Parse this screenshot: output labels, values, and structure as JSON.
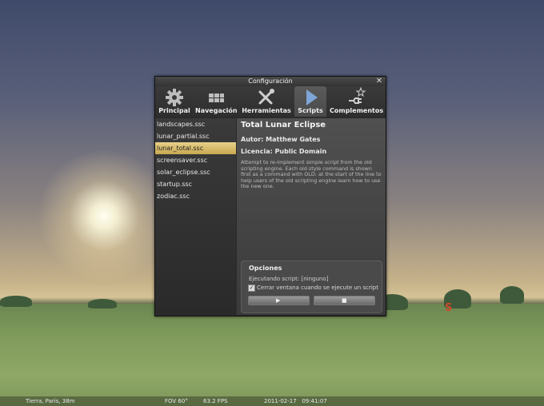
{
  "window": {
    "title": "Configuración",
    "close_glyph": "✕"
  },
  "tabs": [
    {
      "label": "Principal",
      "icon": "gear-icon"
    },
    {
      "label": "Navegación",
      "icon": "navigation-icon"
    },
    {
      "label": "Herramientas",
      "icon": "tools-icon"
    },
    {
      "label": "Scripts",
      "icon": "play-icon",
      "active": true
    },
    {
      "label": "Complementos",
      "icon": "plugin-icon"
    }
  ],
  "scripts": [
    {
      "name": "landscapes.ssc"
    },
    {
      "name": "lunar_partial.ssc"
    },
    {
      "name": "lunar_total.ssc",
      "selected": true
    },
    {
      "name": "screensaver.ssc"
    },
    {
      "name": "solar_eclipse.ssc"
    },
    {
      "name": "startup.ssc"
    },
    {
      "name": "zodiac.ssc"
    }
  ],
  "script_info": {
    "title": "Total Lunar Eclipse",
    "author": "Autor: Matthew Gates",
    "license": "Licencia: Public Domain",
    "description": "Attempt to re-implement simple script from the old scripting engine. Each old style command is shown first as a command with OLD: at the start of the line to help users of the old scripting engine learn how to use the new one."
  },
  "options": {
    "title": "Opciones",
    "running": "Ejecutando script: [ninguno]",
    "close_window_label": "Cerrar ventana cuando se ejecute un script",
    "close_window_checked": true,
    "check_glyph": "✓",
    "run_glyph": "▶",
    "stop_glyph": "■"
  },
  "status_bar": {
    "location": "Tierra, Paris, 38m",
    "fov": "FOV 60°",
    "fps": "63.2 FPS",
    "datetime": "2011-02-17   09:41:07"
  },
  "sky": {
    "cardinal": "S"
  },
  "colors": {
    "accent_selected": "#d9bb6a",
    "panel_bg": "#2b2b2b",
    "cardinal_red": "#d04a28"
  }
}
